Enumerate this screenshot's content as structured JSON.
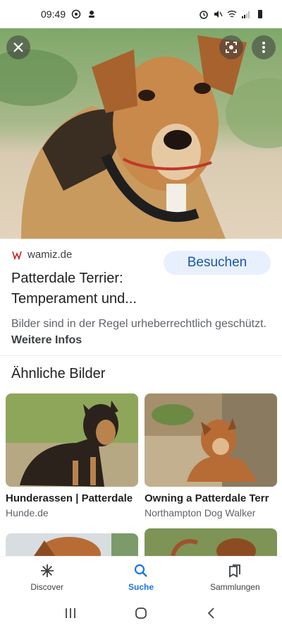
{
  "status_bar": {
    "time": "09:49"
  },
  "hero": {
    "close_icon": "close-icon",
    "lens_icon": "lens-icon",
    "more_icon": "more-vert-icon"
  },
  "result": {
    "source": "wamiz.de",
    "visit_label": "Besuchen",
    "title": "Patterdale Terrier: Temperament und...",
    "copyright_text": "Bilder sind in der Regel urheberrechtlich geschützt.",
    "more_info_label": "Weitere Infos"
  },
  "similar": {
    "heading": "Ähnliche Bilder",
    "items": [
      {
        "title": "Hunderassen | Patterdale",
        "source": "Hunde.de"
      },
      {
        "title": "Owning a Patterdale Terr",
        "source": "Northampton Dog Walker"
      },
      {
        "title": "",
        "source": ""
      },
      {
        "title": "",
        "source": ""
      }
    ]
  },
  "bottom_nav": {
    "items": [
      {
        "label": "Discover",
        "icon": "asterisk-icon"
      },
      {
        "label": "Suche",
        "icon": "search-icon"
      },
      {
        "label": "Sammlungen",
        "icon": "collections-icon"
      }
    ],
    "active": "Suche"
  },
  "colors": {
    "accent": "#1a73e8",
    "visit_bg": "#e8f0fe",
    "visit_text": "#1a56a8"
  }
}
